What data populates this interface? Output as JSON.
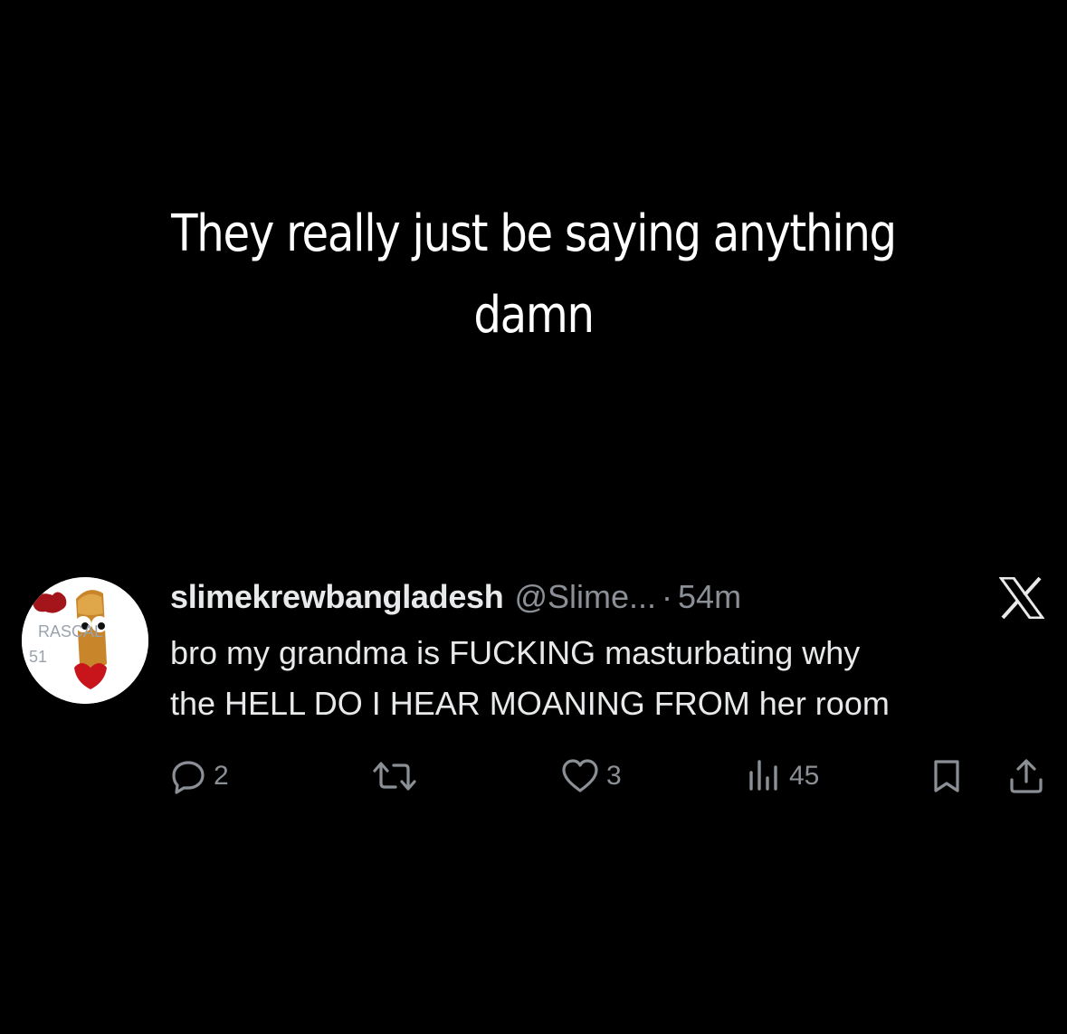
{
  "caption": {
    "line1": "They really just be saying anything",
    "line2": "damn"
  },
  "tweet": {
    "display_name": "slimekrewbangladesh",
    "handle": "@Slime...",
    "separator": "·",
    "time": "54m",
    "text_line1": "bro my grandma is FUCKING masturbating why",
    "text_line2": "the HELL DO I HEAR MOANING FROM her room",
    "avatar_text_top": "RASCAL",
    "avatar_text_bottom": "51",
    "actions": {
      "reply_count": "2",
      "like_count": "3",
      "views_count": "45"
    }
  },
  "icons": {
    "platform": "x-logo-icon",
    "reply": "reply-icon",
    "retweet": "retweet-icon",
    "like": "heart-icon",
    "views": "views-icon",
    "bookmark": "bookmark-icon",
    "share": "share-icon"
  },
  "colors": {
    "background": "#000000",
    "primary_text": "#e7e9ea",
    "secondary_text": "#8b9096",
    "caption_text": "#ffffff"
  }
}
